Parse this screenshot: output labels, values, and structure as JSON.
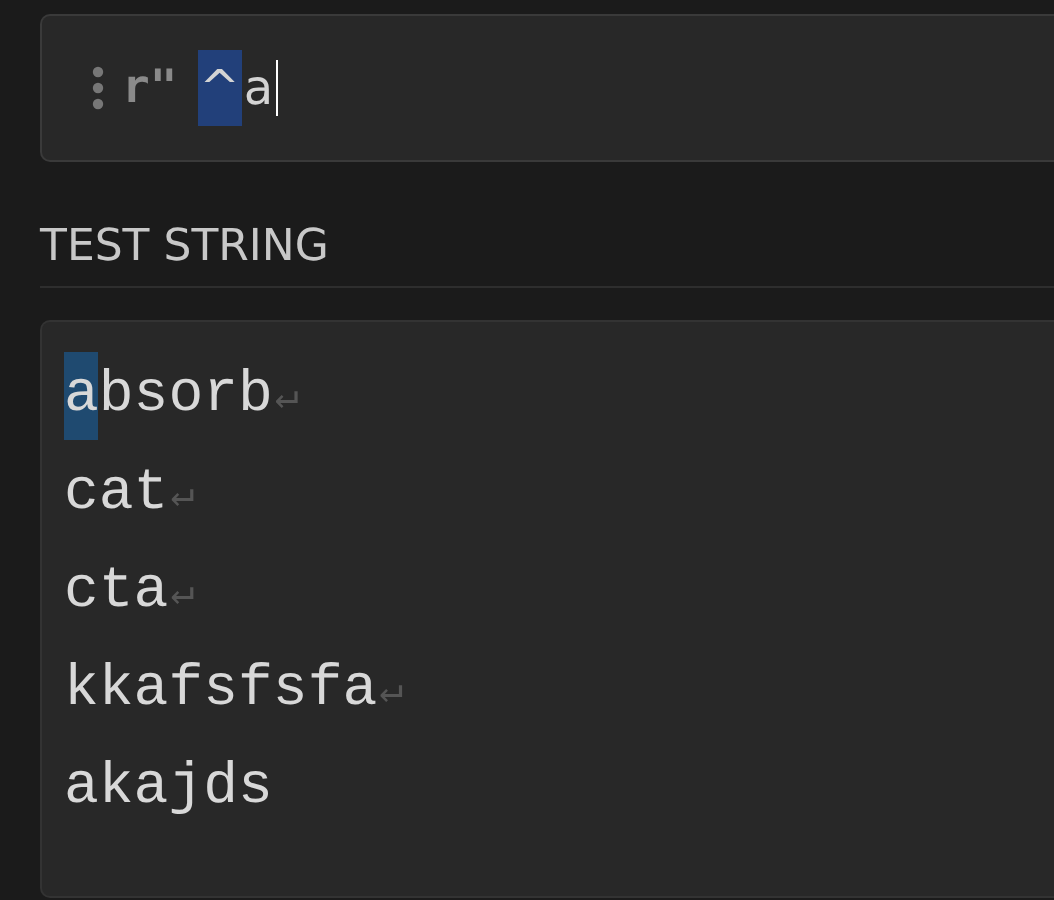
{
  "regex_field": {
    "delimiter": "r\"",
    "tokens": [
      {
        "text": "^",
        "highlighted": true
      },
      {
        "text": "a",
        "highlighted": false
      }
    ],
    "cursor": true
  },
  "test_string": {
    "heading": "TEST STRING",
    "lines": [
      {
        "segments": [
          {
            "text": "a",
            "match": true
          },
          {
            "text": "bsorb",
            "match": false
          }
        ],
        "end_mark": "↵"
      },
      {
        "segments": [
          {
            "text": "cat",
            "match": false
          }
        ],
        "end_mark": "↵"
      },
      {
        "segments": [
          {
            "text": "cta",
            "match": false
          }
        ],
        "end_mark": "↵"
      },
      {
        "segments": [
          {
            "text": "kkafsfsfa",
            "match": false
          }
        ],
        "end_mark": "↵"
      },
      {
        "segments": [
          {
            "text": "akajds",
            "match": false
          }
        ]
      }
    ]
  }
}
